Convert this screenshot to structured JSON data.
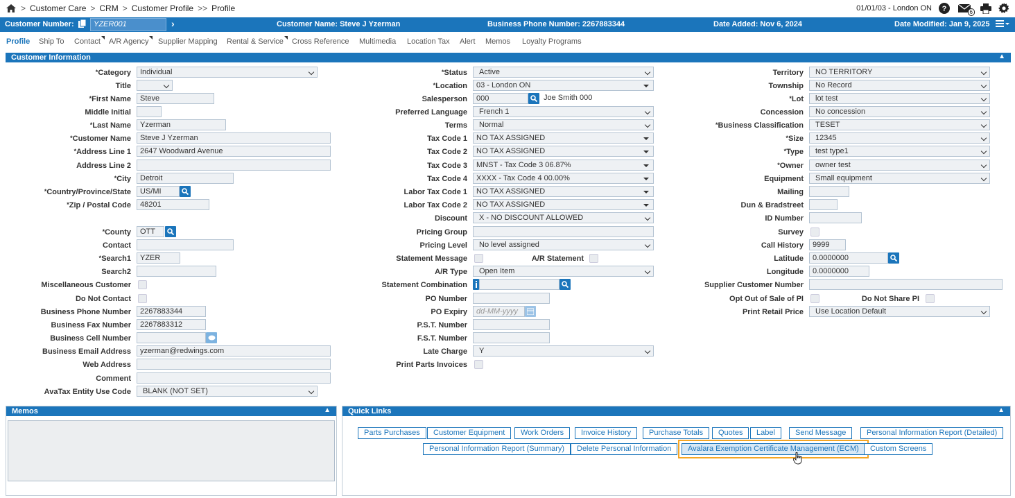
{
  "breadcrumbs": {
    "sep1": ">",
    "item1": "Customer Care",
    "sep2": ">",
    "item2": "CRM",
    "sep3": ">",
    "item3": "Customer Profile",
    "sep4": ">>",
    "item4": "Profile"
  },
  "topright": {
    "location": "01/01/03 - London ON",
    "mail_count": "6"
  },
  "header": {
    "customer_number_label": "Customer Number:",
    "customer_number": "YZER001",
    "customer_name": "Customer Name: Steve J Yzerman",
    "business_phone": "Business Phone Number: 2267883344",
    "date_added": "Date Added: Nov 6, 2024",
    "date_modified": "Date Modified: Jan 9, 2025"
  },
  "tabs": [
    "Profile",
    "Ship To",
    "Contact",
    "A/R Agency",
    "Supplier Mapping",
    "Rental & Service",
    "Cross Reference",
    "Multimedia",
    "Location Tax",
    "Alert",
    "Memos",
    "Loyalty Programs"
  ],
  "panels": {
    "customer_info": "Customer Information",
    "memos": "Memos",
    "quick_links": "Quick Links"
  },
  "col1": {
    "category": {
      "label": "Category",
      "value": "Individual"
    },
    "title": {
      "label": "Title",
      "value": ""
    },
    "first_name": {
      "label": "First Name",
      "value": "Steve"
    },
    "middle_initial": {
      "label": "Middle Initial",
      "value": ""
    },
    "last_name": {
      "label": "Last Name",
      "value": "Yzerman"
    },
    "customer_name": {
      "label": "Customer Name",
      "value": "Steve J Yzerman"
    },
    "address1": {
      "label": "Address Line 1",
      "value": "2647 Woodward Avenue"
    },
    "address2": {
      "label": "Address Line 2",
      "value": ""
    },
    "city": {
      "label": "City",
      "value": "Detroit"
    },
    "country": {
      "label": "Country/Province/State",
      "value": "US/MI"
    },
    "zip": {
      "label": "Zip / Postal Code",
      "value": "48201"
    },
    "county": {
      "label": "County",
      "value": "OTT"
    },
    "contact": {
      "label": "Contact",
      "value": ""
    },
    "search1": {
      "label": "Search1",
      "value": "YZER"
    },
    "search2": {
      "label": "Search2",
      "value": ""
    },
    "misc_customer": {
      "label": "Miscellaneous Customer"
    },
    "do_not_contact": {
      "label": "Do Not Contact"
    },
    "business_phone": {
      "label": "Business Phone Number",
      "value": "2267883344"
    },
    "business_fax": {
      "label": "Business Fax Number",
      "value": "2267883312"
    },
    "business_cell": {
      "label": "Business Cell Number",
      "value": ""
    },
    "business_email": {
      "label": "Business Email Address",
      "value": "yzerman@redwings.com"
    },
    "web_address": {
      "label": "Web Address",
      "value": ""
    },
    "comment": {
      "label": "Comment",
      "value": ""
    },
    "avatax": {
      "label": "AvaTax Entity Use Code",
      "value": "BLANK (NOT SET)"
    }
  },
  "col2": {
    "status": {
      "label": "Status",
      "value": "Active"
    },
    "location": {
      "label": "Location",
      "value": "03 - London ON"
    },
    "salesperson": {
      "label": "Salesperson",
      "value": "000",
      "name": "Joe Smith 000"
    },
    "language": {
      "label": "Preferred Language",
      "value": "French 1"
    },
    "terms": {
      "label": "Terms",
      "value": "Normal"
    },
    "tax1": {
      "label": "Tax Code 1",
      "value": "NO TAX ASSIGNED"
    },
    "tax2": {
      "label": "Tax Code 2",
      "value": "NO TAX ASSIGNED"
    },
    "tax3": {
      "label": "Tax Code 3",
      "value": "MNST - Tax Code 3 06.87%"
    },
    "tax4": {
      "label": "Tax Code 4",
      "value": "XXXX - Tax Code 4 00.00%"
    },
    "labor1": {
      "label": "Labor Tax Code 1",
      "value": "NO TAX ASSIGNED"
    },
    "labor2": {
      "label": "Labor Tax Code 2",
      "value": "NO TAX ASSIGNED"
    },
    "discount": {
      "label": "Discount",
      "value": "X - NO DISCOUNT ALLOWED"
    },
    "pricing_group": {
      "label": "Pricing Group",
      "value": ""
    },
    "pricing_level": {
      "label": "Pricing Level",
      "value": "No level assigned"
    },
    "statement_message": {
      "label": "Statement Message"
    },
    "ar_statement": {
      "label": "A/R Statement"
    },
    "ar_type": {
      "label": "A/R Type",
      "value": "Open Item"
    },
    "statement_combo": {
      "label": "Statement Combination",
      "value": ""
    },
    "po_number": {
      "label": "PO Number",
      "value": ""
    },
    "po_expiry": {
      "label": "PO Expiry",
      "placeholder": "dd-MM-yyyy"
    },
    "pst": {
      "label": "P.S.T. Number",
      "value": ""
    },
    "fst": {
      "label": "F.S.T. Number",
      "value": ""
    },
    "late_charge": {
      "label": "Late Charge",
      "value": "Y"
    },
    "print_parts": {
      "label": "Print Parts Invoices"
    }
  },
  "col3": {
    "territory": {
      "label": "Territory",
      "value": "NO TERRITORY"
    },
    "township": {
      "label": "Township",
      "value": "No Record"
    },
    "lot": {
      "label": "Lot",
      "value": "lot test"
    },
    "concession": {
      "label": "Concession",
      "value": "No concession"
    },
    "biz_class": {
      "label": "Business Classification",
      "value": "TESET"
    },
    "size": {
      "label": "Size",
      "value": "12345"
    },
    "type": {
      "label": "Type",
      "value": "test type1"
    },
    "owner": {
      "label": "Owner",
      "value": "owner test"
    },
    "equipment": {
      "label": "Equipment",
      "value": "Small equipment"
    },
    "mailing": {
      "label": "Mailing",
      "value": ""
    },
    "dun": {
      "label": "Dun & Bradstreet",
      "value": ""
    },
    "id_number": {
      "label": "ID Number",
      "value": ""
    },
    "survey": {
      "label": "Survey"
    },
    "call_history": {
      "label": "Call History",
      "value": "9999"
    },
    "latitude": {
      "label": "Latitude",
      "value": "0.0000000"
    },
    "longitude": {
      "label": "Longitude",
      "value": "0.0000000"
    },
    "supplier_cust": {
      "label": "Supplier Customer Number",
      "value": ""
    },
    "opt_out": {
      "label": "Opt Out of Sale of PI"
    },
    "do_not_share": {
      "label": "Do Not Share PI"
    },
    "print_retail": {
      "label": "Print Retail Price",
      "value": "Use Location Default"
    }
  },
  "required_mark": "*",
  "quick_links": [
    "Parts Purchases",
    "Customer Equipment",
    "Work Orders",
    "Invoice History",
    "Purchase Totals",
    "Quotes",
    "Label",
    "Send Message",
    "Personal Information Report (Detailed)",
    "Personal Information Report (Summary)",
    "Delete Personal Information",
    "Avalara Exemption Certificate Management (ECM)",
    "Custom Screens"
  ],
  "colors": {
    "brand": "#1b75bb",
    "highlight": "#f5a623"
  }
}
